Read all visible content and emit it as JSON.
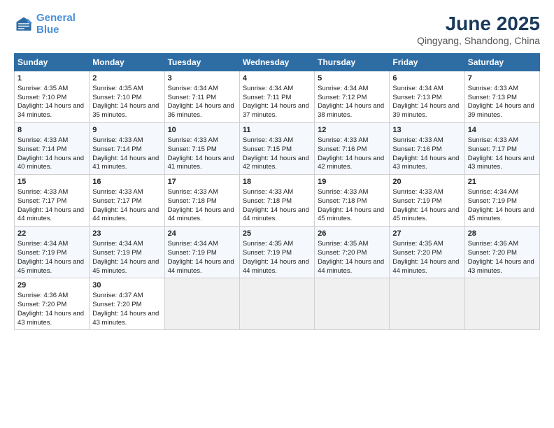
{
  "logo": {
    "line1": "General",
    "line2": "Blue"
  },
  "title": "June 2025",
  "subtitle": "Qingyang, Shandong, China",
  "days_header": [
    "Sunday",
    "Monday",
    "Tuesday",
    "Wednesday",
    "Thursday",
    "Friday",
    "Saturday"
  ],
  "weeks": [
    [
      {
        "num": "1",
        "sunrise": "Sunrise: 4:35 AM",
        "sunset": "Sunset: 7:10 PM",
        "daylight": "Daylight: 14 hours and 34 minutes."
      },
      {
        "num": "2",
        "sunrise": "Sunrise: 4:35 AM",
        "sunset": "Sunset: 7:10 PM",
        "daylight": "Daylight: 14 hours and 35 minutes."
      },
      {
        "num": "3",
        "sunrise": "Sunrise: 4:34 AM",
        "sunset": "Sunset: 7:11 PM",
        "daylight": "Daylight: 14 hours and 36 minutes."
      },
      {
        "num": "4",
        "sunrise": "Sunrise: 4:34 AM",
        "sunset": "Sunset: 7:11 PM",
        "daylight": "Daylight: 14 hours and 37 minutes."
      },
      {
        "num": "5",
        "sunrise": "Sunrise: 4:34 AM",
        "sunset": "Sunset: 7:12 PM",
        "daylight": "Daylight: 14 hours and 38 minutes."
      },
      {
        "num": "6",
        "sunrise": "Sunrise: 4:34 AM",
        "sunset": "Sunset: 7:13 PM",
        "daylight": "Daylight: 14 hours and 39 minutes."
      },
      {
        "num": "7",
        "sunrise": "Sunrise: 4:33 AM",
        "sunset": "Sunset: 7:13 PM",
        "daylight": "Daylight: 14 hours and 39 minutes."
      }
    ],
    [
      {
        "num": "8",
        "sunrise": "Sunrise: 4:33 AM",
        "sunset": "Sunset: 7:14 PM",
        "daylight": "Daylight: 14 hours and 40 minutes."
      },
      {
        "num": "9",
        "sunrise": "Sunrise: 4:33 AM",
        "sunset": "Sunset: 7:14 PM",
        "daylight": "Daylight: 14 hours and 41 minutes."
      },
      {
        "num": "10",
        "sunrise": "Sunrise: 4:33 AM",
        "sunset": "Sunset: 7:15 PM",
        "daylight": "Daylight: 14 hours and 41 minutes."
      },
      {
        "num": "11",
        "sunrise": "Sunrise: 4:33 AM",
        "sunset": "Sunset: 7:15 PM",
        "daylight": "Daylight: 14 hours and 42 minutes."
      },
      {
        "num": "12",
        "sunrise": "Sunrise: 4:33 AM",
        "sunset": "Sunset: 7:16 PM",
        "daylight": "Daylight: 14 hours and 42 minutes."
      },
      {
        "num": "13",
        "sunrise": "Sunrise: 4:33 AM",
        "sunset": "Sunset: 7:16 PM",
        "daylight": "Daylight: 14 hours and 43 minutes."
      },
      {
        "num": "14",
        "sunrise": "Sunrise: 4:33 AM",
        "sunset": "Sunset: 7:17 PM",
        "daylight": "Daylight: 14 hours and 43 minutes."
      }
    ],
    [
      {
        "num": "15",
        "sunrise": "Sunrise: 4:33 AM",
        "sunset": "Sunset: 7:17 PM",
        "daylight": "Daylight: 14 hours and 44 minutes."
      },
      {
        "num": "16",
        "sunrise": "Sunrise: 4:33 AM",
        "sunset": "Sunset: 7:17 PM",
        "daylight": "Daylight: 14 hours and 44 minutes."
      },
      {
        "num": "17",
        "sunrise": "Sunrise: 4:33 AM",
        "sunset": "Sunset: 7:18 PM",
        "daylight": "Daylight: 14 hours and 44 minutes."
      },
      {
        "num": "18",
        "sunrise": "Sunrise: 4:33 AM",
        "sunset": "Sunset: 7:18 PM",
        "daylight": "Daylight: 14 hours and 44 minutes."
      },
      {
        "num": "19",
        "sunrise": "Sunrise: 4:33 AM",
        "sunset": "Sunset: 7:18 PM",
        "daylight": "Daylight: 14 hours and 45 minutes."
      },
      {
        "num": "20",
        "sunrise": "Sunrise: 4:33 AM",
        "sunset": "Sunset: 7:19 PM",
        "daylight": "Daylight: 14 hours and 45 minutes."
      },
      {
        "num": "21",
        "sunrise": "Sunrise: 4:34 AM",
        "sunset": "Sunset: 7:19 PM",
        "daylight": "Daylight: 14 hours and 45 minutes."
      }
    ],
    [
      {
        "num": "22",
        "sunrise": "Sunrise: 4:34 AM",
        "sunset": "Sunset: 7:19 PM",
        "daylight": "Daylight: 14 hours and 45 minutes."
      },
      {
        "num": "23",
        "sunrise": "Sunrise: 4:34 AM",
        "sunset": "Sunset: 7:19 PM",
        "daylight": "Daylight: 14 hours and 45 minutes."
      },
      {
        "num": "24",
        "sunrise": "Sunrise: 4:34 AM",
        "sunset": "Sunset: 7:19 PM",
        "daylight": "Daylight: 14 hours and 44 minutes."
      },
      {
        "num": "25",
        "sunrise": "Sunrise: 4:35 AM",
        "sunset": "Sunset: 7:19 PM",
        "daylight": "Daylight: 14 hours and 44 minutes."
      },
      {
        "num": "26",
        "sunrise": "Sunrise: 4:35 AM",
        "sunset": "Sunset: 7:20 PM",
        "daylight": "Daylight: 14 hours and 44 minutes."
      },
      {
        "num": "27",
        "sunrise": "Sunrise: 4:35 AM",
        "sunset": "Sunset: 7:20 PM",
        "daylight": "Daylight: 14 hours and 44 minutes."
      },
      {
        "num": "28",
        "sunrise": "Sunrise: 4:36 AM",
        "sunset": "Sunset: 7:20 PM",
        "daylight": "Daylight: 14 hours and 43 minutes."
      }
    ],
    [
      {
        "num": "29",
        "sunrise": "Sunrise: 4:36 AM",
        "sunset": "Sunset: 7:20 PM",
        "daylight": "Daylight: 14 hours and 43 minutes."
      },
      {
        "num": "30",
        "sunrise": "Sunrise: 4:37 AM",
        "sunset": "Sunset: 7:20 PM",
        "daylight": "Daylight: 14 hours and 43 minutes."
      },
      null,
      null,
      null,
      null,
      null
    ]
  ]
}
